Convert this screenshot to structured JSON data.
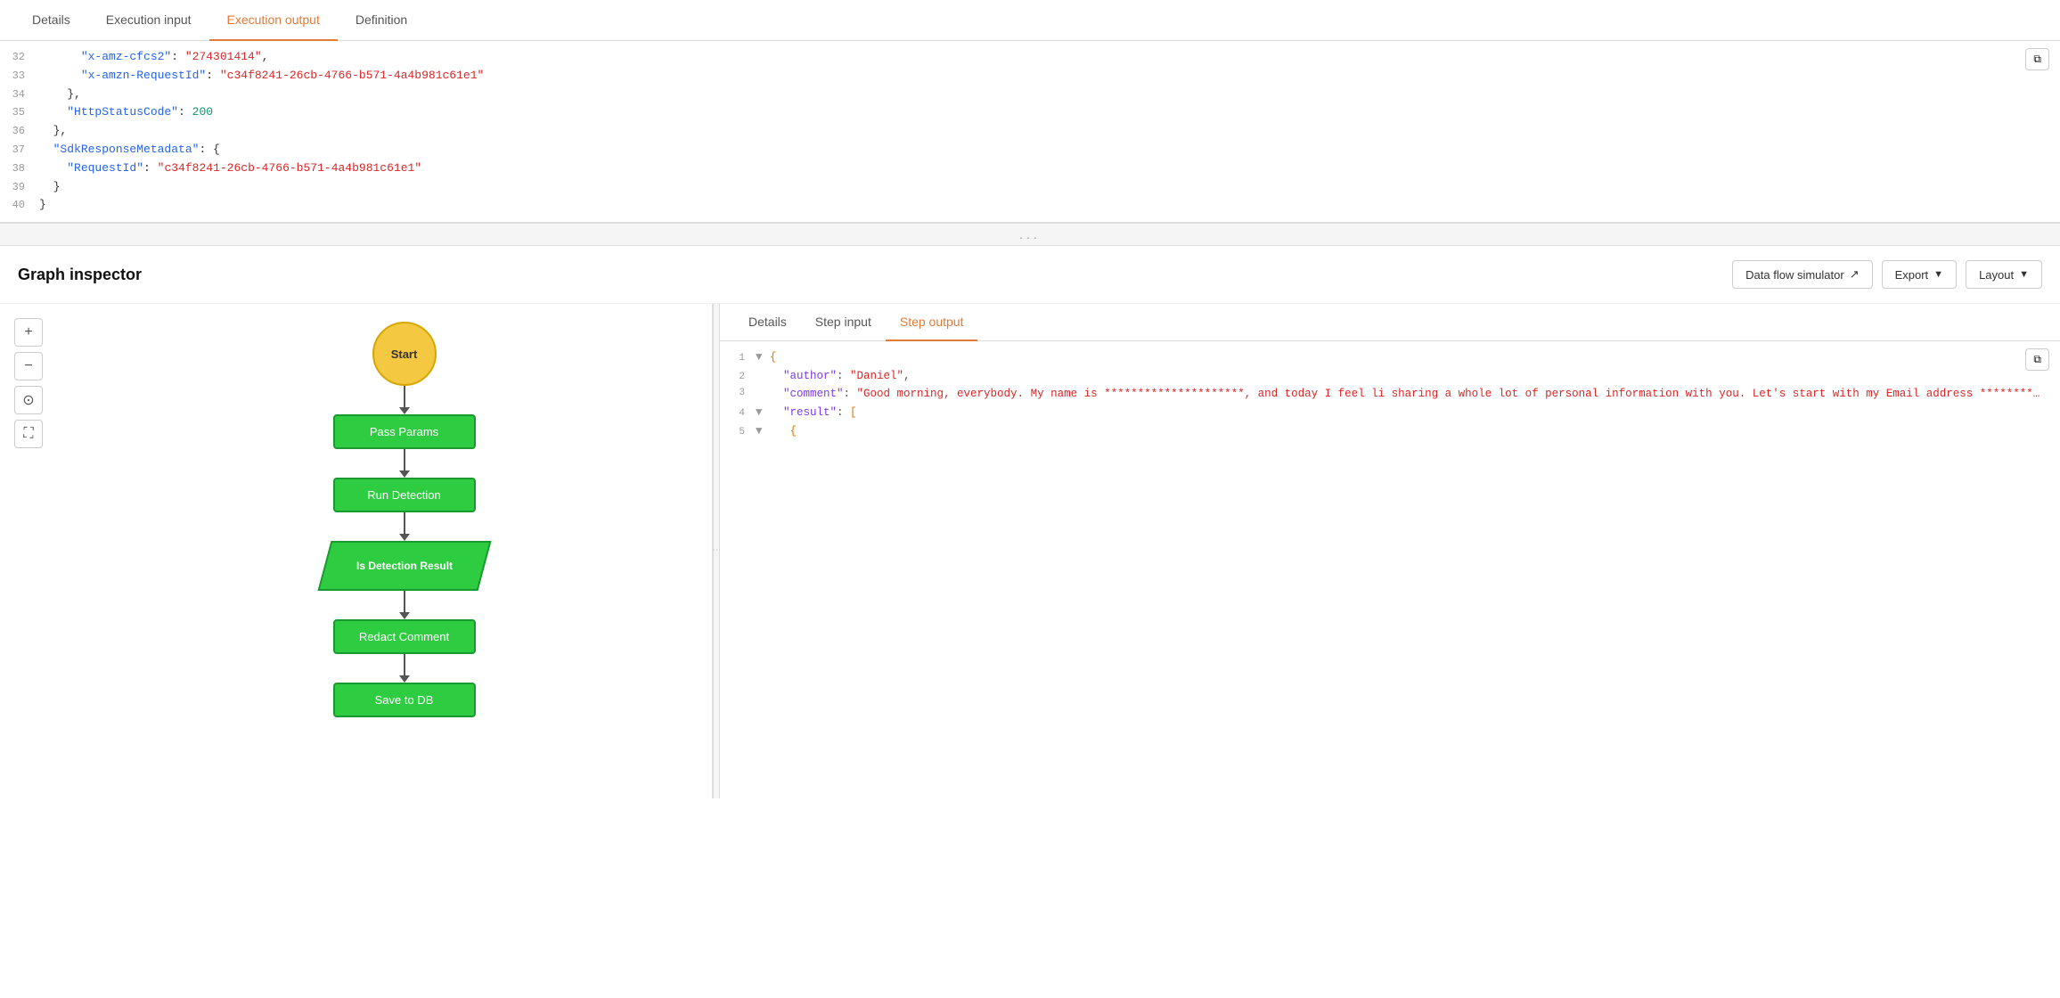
{
  "topTabs": {
    "items": [
      {
        "id": "details",
        "label": "Details",
        "active": false
      },
      {
        "id": "execution-input",
        "label": "Execution input",
        "active": false
      },
      {
        "id": "execution-output",
        "label": "Execution output",
        "active": true
      },
      {
        "id": "definition",
        "label": "Definition",
        "active": false
      }
    ]
  },
  "codeSection": {
    "lines": [
      {
        "num": "32",
        "indent": "      ",
        "content": "\"x-amz-cfcs2\": \"274301414\",",
        "type": "key-val-str"
      },
      {
        "num": "33",
        "indent": "      ",
        "content_key": "\"x-amzn-RequestId\"",
        "content_val": "\"c34f8241-26cb-4766-b571-4a4b981c61e1\"",
        "type": "kv"
      },
      {
        "num": "34",
        "indent": "    },",
        "type": "plain"
      },
      {
        "num": "35",
        "indent": "    ",
        "content_key": "\"HttpStatusCode\"",
        "content_val": "200",
        "type": "kv-num"
      },
      {
        "num": "36",
        "indent": "  },",
        "type": "plain"
      },
      {
        "num": "37",
        "indent": "  ",
        "content_key": "\"SdkResponseMetadata\"",
        "content_val": "{",
        "type": "kv-open"
      },
      {
        "num": "38",
        "indent": "    ",
        "content_key": "\"RequestId\"",
        "content_val": "\"c34f8241-26cb-4766-b571-4a4b981c61e1\"",
        "type": "kv"
      },
      {
        "num": "39",
        "indent": "  }",
        "type": "plain"
      },
      {
        "num": "40",
        "indent": "}",
        "type": "plain"
      }
    ]
  },
  "resizeHandle": "...",
  "graphInspector": {
    "title": "Graph inspector",
    "buttons": [
      {
        "label": "Data flow simulator",
        "icon": "external-link-icon"
      },
      {
        "label": "Export",
        "icon": "chevron-down-icon"
      },
      {
        "label": "Layout",
        "icon": "chevron-down-icon"
      }
    ]
  },
  "flowControls": [
    {
      "icon": "+",
      "name": "zoom-in"
    },
    {
      "icon": "−",
      "name": "zoom-out"
    },
    {
      "icon": "⊙",
      "name": "center"
    },
    {
      "icon": "⛶",
      "name": "fit"
    }
  ],
  "flowNodes": [
    {
      "id": "start",
      "label": "Start",
      "type": "start"
    },
    {
      "id": "pass-params",
      "label": "Pass Params",
      "type": "green"
    },
    {
      "id": "run-detection",
      "label": "Run Detection",
      "type": "green"
    },
    {
      "id": "is-detection-result",
      "label": "Is Detection Result",
      "type": "diamond"
    },
    {
      "id": "redact-comment",
      "label": "Redact Comment",
      "type": "green"
    },
    {
      "id": "save-to-db",
      "label": "Save to DB",
      "type": "green"
    }
  ],
  "detailsTabs": {
    "items": [
      {
        "id": "details",
        "label": "Details",
        "active": false
      },
      {
        "id": "step-input",
        "label": "Step input",
        "active": false
      },
      {
        "id": "step-output",
        "label": "Step output",
        "active": true
      }
    ]
  },
  "jsonOutput": {
    "lines": [
      {
        "num": "1",
        "toggle": "▼",
        "content": "{",
        "type": "brace-open"
      },
      {
        "num": "2",
        "toggle": " ",
        "content_key": "\"author\"",
        "content_val": "\"Daniel\",",
        "type": "kv"
      },
      {
        "num": "3",
        "toggle": " ",
        "content_key": "\"comment\"",
        "content_val": "\"Good morning, everybody. My name is *********************, and today I feel li sharing a whole lot of personal information with you. Let's start with my Email address ************************. My address is ********************************* My phone numbers ************. My Social security number is **********. My Bank account number is ******** and routing number *********. My credit card number is **************, Expiration De ********, my C V V code is ***, and my pin *****. Well, I think that's it. You know a w le lot about me. And I hope that Amazon comprehend is doing a good job at identifying PII tities so you can redact my personal information away from this document. Let's check.\",",
        "type": "kv-long"
      },
      {
        "num": "4",
        "toggle": "▼",
        "content_key": "\"result\"",
        "content_val": "[",
        "type": "kv-open"
      },
      {
        "num": "5",
        "toggle": "▼",
        "content": "  {",
        "type": "brace-open"
      }
    ]
  }
}
